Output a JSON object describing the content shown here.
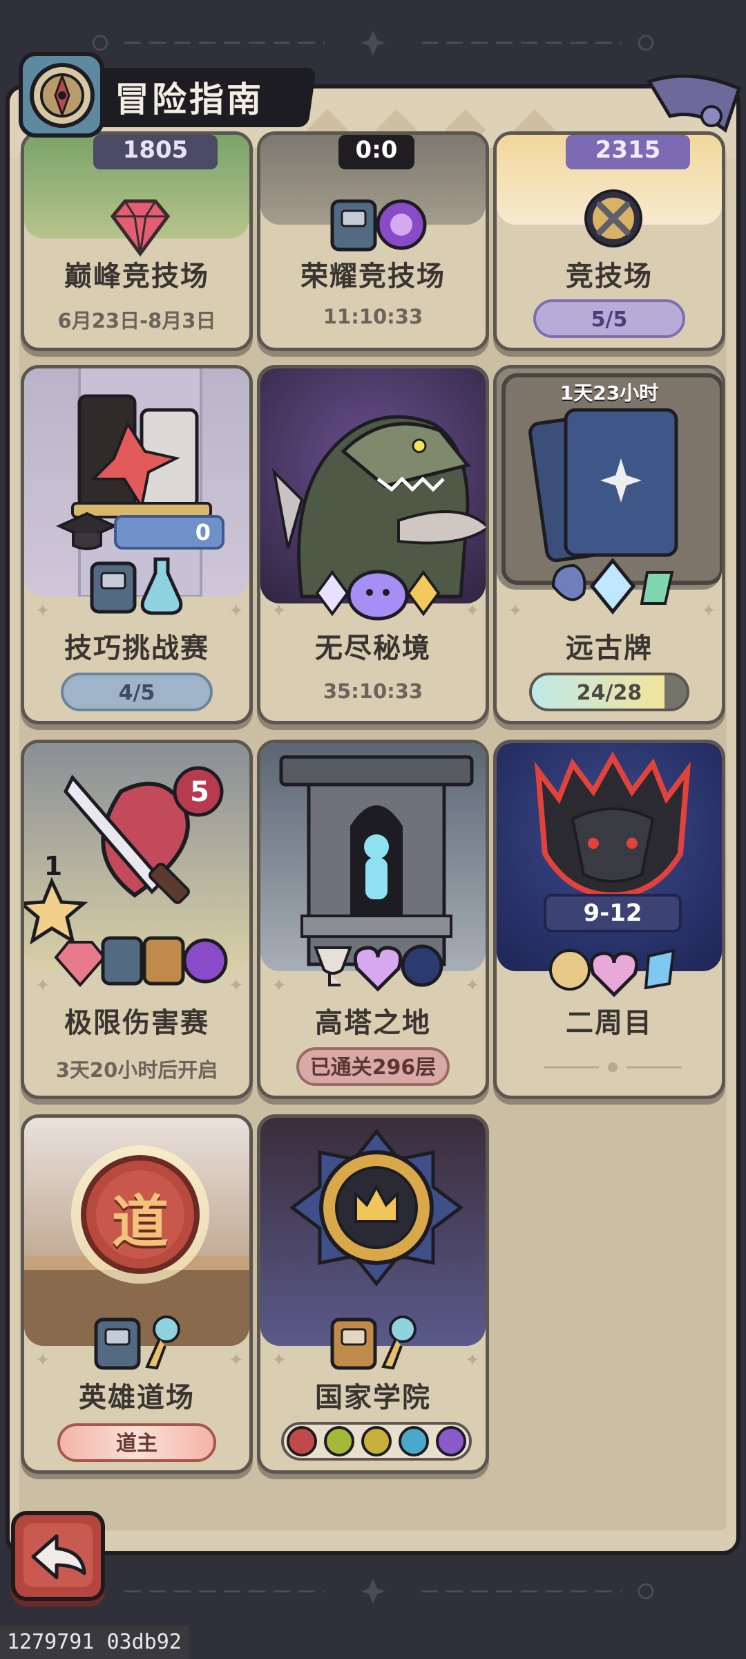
{
  "header": {
    "title": "冒险指南"
  },
  "cards": [
    {
      "id": "peak-arena",
      "name": "巅峰竞技场",
      "sub": "6月23日-8月3日",
      "badge": "1805"
    },
    {
      "id": "glory-arena",
      "name": "荣耀竞技场",
      "sub": "11:10:33",
      "badge": "0:0"
    },
    {
      "id": "arena",
      "name": "竞技场",
      "pill": "5/5",
      "badge": "2315"
    },
    {
      "id": "skill-challenge",
      "name": "技巧挑战赛",
      "pill": "4/5",
      "badge": "0"
    },
    {
      "id": "endless-realm",
      "name": "无尽秘境",
      "sub": "35:10:33"
    },
    {
      "id": "ancient-cards",
      "name": "远古牌",
      "pill": "24/28",
      "progress": 0.857,
      "timer": "1天23小时"
    },
    {
      "id": "extreme-damage",
      "name": "极限伤害赛",
      "sub": "3天20小时后开启",
      "badge": "5",
      "star": "1"
    },
    {
      "id": "tower-land",
      "name": "高塔之地",
      "pill": "已通关296层"
    },
    {
      "id": "second-round",
      "name": "二周目",
      "badge": "9-12"
    },
    {
      "id": "hero-dojo",
      "name": "英雄道场",
      "pill": "道主",
      "emblem": "道"
    },
    {
      "id": "national-academy",
      "name": "国家学院"
    }
  ],
  "footer": {
    "id_text": "1279791 03db92"
  },
  "colors": {
    "panel": "#d8ccb2",
    "pill_purple": "#b7acd8",
    "pill_blue": "#9fb4c8",
    "pill_pink": "#d9a9a6"
  }
}
